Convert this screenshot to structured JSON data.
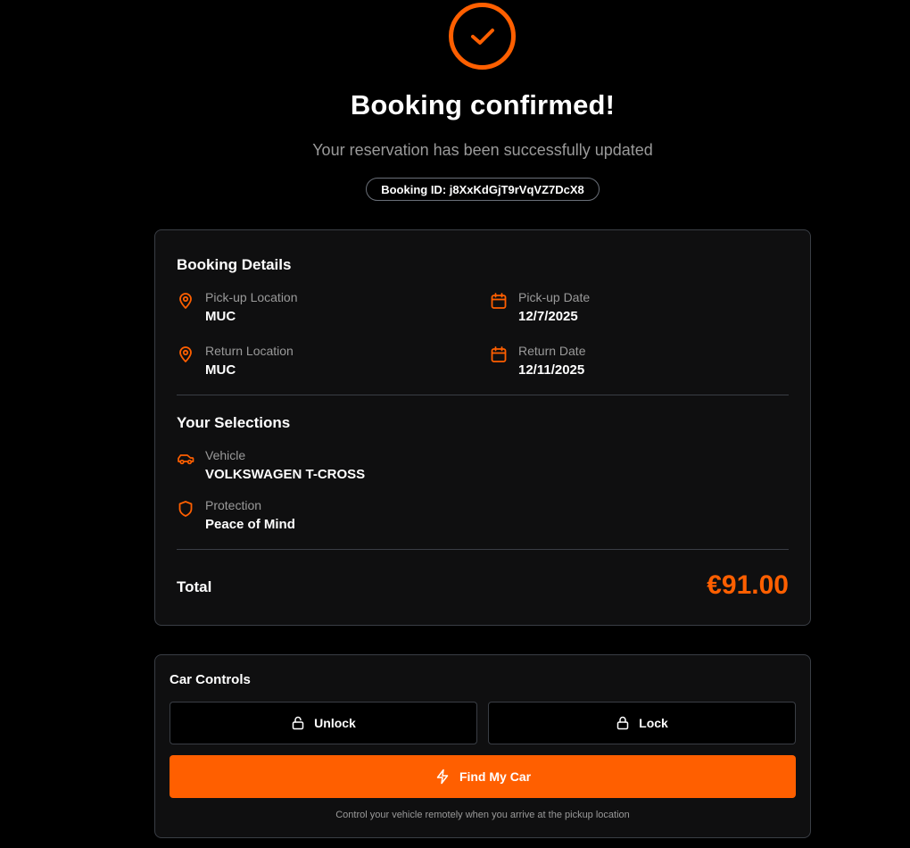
{
  "header": {
    "title": "Booking confirmed!",
    "subtitle": "Your reservation has been successfully updated",
    "booking_id": "Booking ID: j8XxKdGjT9rVqVZ7DcX8",
    "accent_color": "#ff5f00"
  },
  "booking_details": {
    "heading": "Booking Details",
    "pickup_location": {
      "label": "Pick-up Location",
      "value": "MUC",
      "icon": "map-pin-icon"
    },
    "pickup_date": {
      "label": "Pick-up Date",
      "value": "12/7/2025",
      "icon": "calendar-icon"
    },
    "return_location": {
      "label": "Return Location",
      "value": "MUC",
      "icon": "map-pin-icon"
    },
    "return_date": {
      "label": "Return Date",
      "value": "12/11/2025",
      "icon": "calendar-icon"
    }
  },
  "selections": {
    "heading": "Your Selections",
    "vehicle": {
      "label": "Vehicle",
      "value": "VOLKSWAGEN T-CROSS",
      "icon": "car-icon"
    },
    "protection": {
      "label": "Protection",
      "value": "Peace of Mind",
      "icon": "shield-icon"
    }
  },
  "total": {
    "label": "Total",
    "value": "€91.00"
  },
  "car_controls": {
    "heading": "Car Controls",
    "unlock_label": "Unlock",
    "lock_label": "Lock",
    "find_label": "Find My Car",
    "helper": "Control your vehicle remotely when you arrive at the pickup location"
  }
}
